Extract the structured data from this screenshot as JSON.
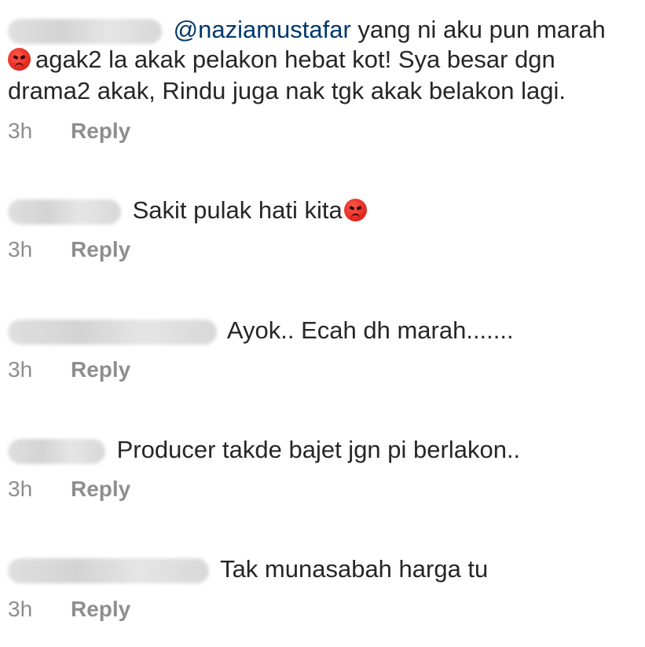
{
  "comments": [
    {
      "mention": "@naziamustafar",
      "line1": " yang ni aku pun marah",
      "line2": "agak2 la akak pelakon hebat kot! Sya besar dgn",
      "line3": "drama2 akak, Rindu juga nak tgk  akak belakon lagi.",
      "time": "3h",
      "reply": "Reply"
    },
    {
      "text": "Sakit pulak hati kita",
      "time": "3h",
      "reply": "Reply"
    },
    {
      "text": "Ayok.. Ecah dh marah.......",
      "time": "3h",
      "reply": "Reply"
    },
    {
      "text": "Producer takde bajet jgn pi berlakon..",
      "time": "3h",
      "reply": "Reply"
    },
    {
      "text": "Tak munasabah harga tu",
      "time": "3h",
      "reply": "Reply"
    }
  ],
  "icons": {
    "emoji": "angry-face-emoji-icon"
  },
  "colors": {
    "mention": "#00376b",
    "meta": "#8e8e8e",
    "text": "#262626"
  }
}
